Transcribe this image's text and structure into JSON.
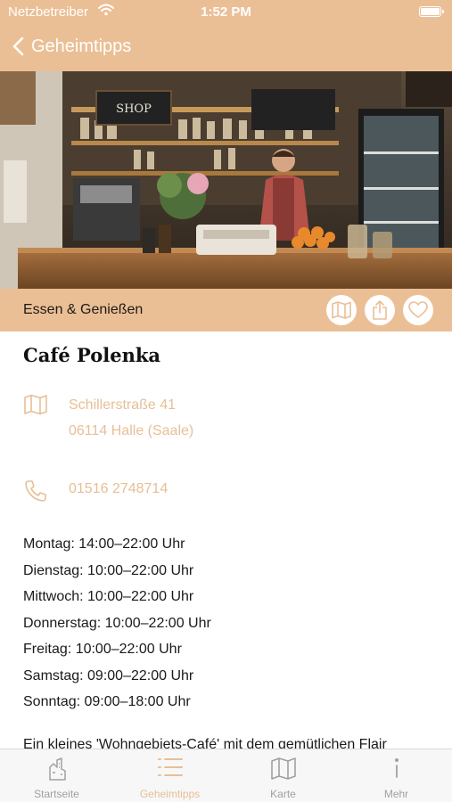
{
  "status_bar": {
    "carrier": "Netzbetreiber",
    "time": "1:52 PM"
  },
  "nav": {
    "back_label": "Geheimtipps"
  },
  "category": {
    "label": "Essen & Genießen"
  },
  "place": {
    "name": "Café Polenka",
    "address_line1": "Schillerstraße 41",
    "address_line2": "06114 Halle (Saale)",
    "phone": "01516 2748714",
    "hours": [
      "Montag: 14:00–22:00 Uhr",
      "Dienstag: 10:00–22:00 Uhr",
      "Mittwoch: 10:00–22:00 Uhr",
      "Donnerstag: 10:00–22:00 Uhr",
      "Freitag: 10:00–22:00 Uhr",
      "Samstag: 09:00–22:00 Uhr",
      "Sonntag: 09:00–18:00 Uhr"
    ],
    "description": "Ein kleines 'Wohngebiets-Café' mit dem gemütlichen Flair"
  },
  "hero": {
    "sign_text": "SHOP"
  },
  "tabs": [
    {
      "label": "Startseite",
      "icon": "city-icon",
      "active": false
    },
    {
      "label": "Geheimtipps",
      "icon": "list-icon",
      "active": true
    },
    {
      "label": "Karte",
      "icon": "map-icon",
      "active": false
    },
    {
      "label": "Mehr",
      "icon": "info-icon",
      "active": false
    }
  ],
  "colors": {
    "accent": "#ebbf95",
    "accent_text": "#e7bf96",
    "inactive": "#a0a0a0"
  }
}
